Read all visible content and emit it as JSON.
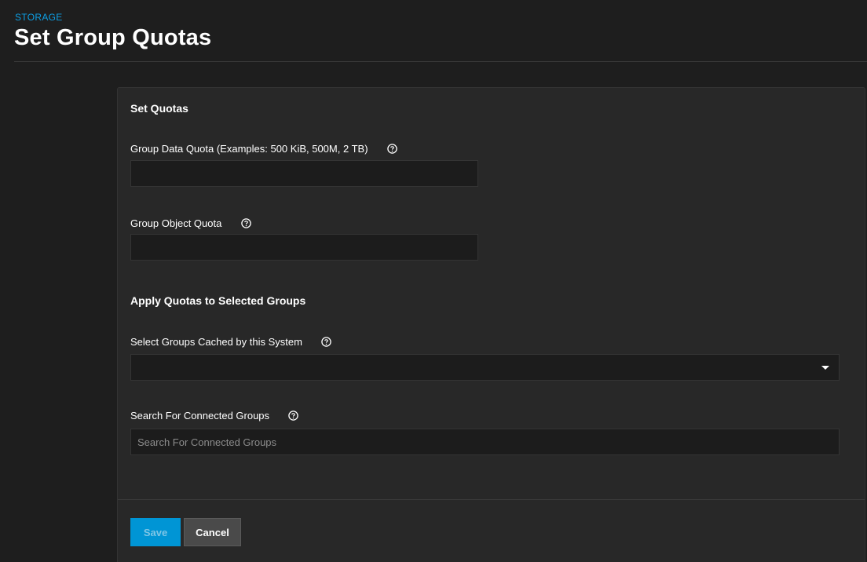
{
  "header": {
    "breadcrumb": "STORAGE",
    "title": "Set Group Quotas"
  },
  "form": {
    "set_quotas_title": "Set Quotas",
    "data_quota_label": "Group Data Quota (Examples: 500 KiB, 500M, 2 TB)",
    "data_quota_value": "",
    "object_quota_label": "Group Object Quota",
    "object_quota_value": "",
    "apply_title": "Apply Quotas to Selected Groups",
    "select_groups_label": "Select Groups Cached by this System",
    "search_label": "Search For Connected Groups",
    "search_placeholder": "Search For Connected Groups",
    "search_value": ""
  },
  "actions": {
    "save_label": "Save",
    "cancel_label": "Cancel"
  },
  "colors": {
    "accent": "#0095d5",
    "breadcrumb": "#0d9fe4",
    "background": "#1e1e1e",
    "card": "#282828"
  },
  "icons": {
    "help": "help-circle-icon",
    "dropdown": "caret-down-icon"
  }
}
